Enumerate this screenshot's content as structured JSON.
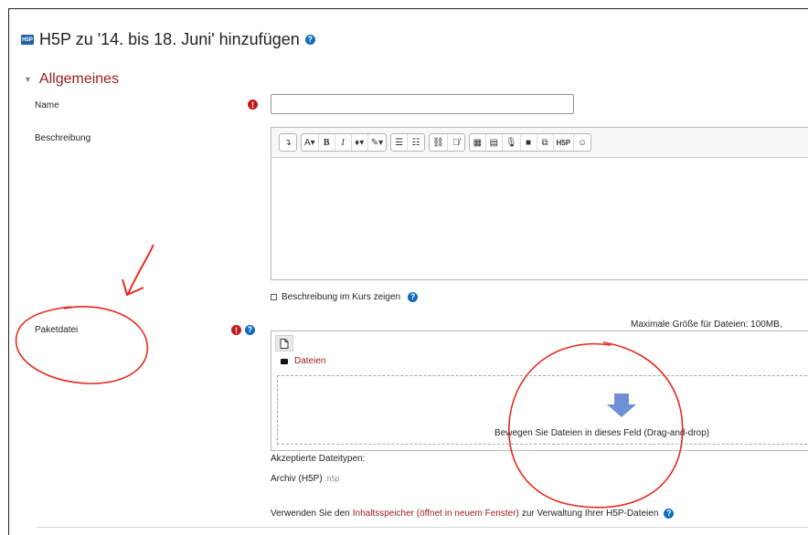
{
  "page": {
    "badge": "H5P",
    "title": "H5P zu '14. bis 18. Juni' hinzufügen"
  },
  "section": {
    "label": "Allgemeines"
  },
  "fields": {
    "name_label": "Name",
    "name_value": "",
    "description_label": "Beschreibung",
    "show_description_label": "Beschreibung im Kurs zeigen",
    "package_label": "Paketdatei"
  },
  "toolbar": {
    "buttons": [
      "↴",
      "A▾",
      "B",
      "I",
      "♦▾",
      "✎▾",
      "☰",
      "☷",
      "⛓",
      "⛓̸",
      "▦",
      "▤",
      "🎙",
      "■",
      "⧉",
      "H5P",
      "☺"
    ]
  },
  "filepicker": {
    "max_size": "Maximale Größe für Dateien: 100MB,",
    "folder_label": "Dateien",
    "drop_text": "Bewegen Sie Dateien in dieses Feld (Drag-and-drop)",
    "accepted_label": "Akzeptierte Dateitypen:",
    "archive_label": "Archiv (H5P)",
    "archive_ext": ".h5p"
  },
  "footer_text": {
    "prefix": "Verwenden Sie den",
    "link": "Inhaltsspeicher (öffnet in neuem Fenster)",
    "suffix": "zur Verwaltung Ihrer H5P-Dateien"
  },
  "colors": {
    "accent": "#0f6cbf",
    "section": "#9b1c1c",
    "required": "#c21a1a",
    "annotation": "#e8291c",
    "drop_arrow": "#6f8fd6"
  }
}
